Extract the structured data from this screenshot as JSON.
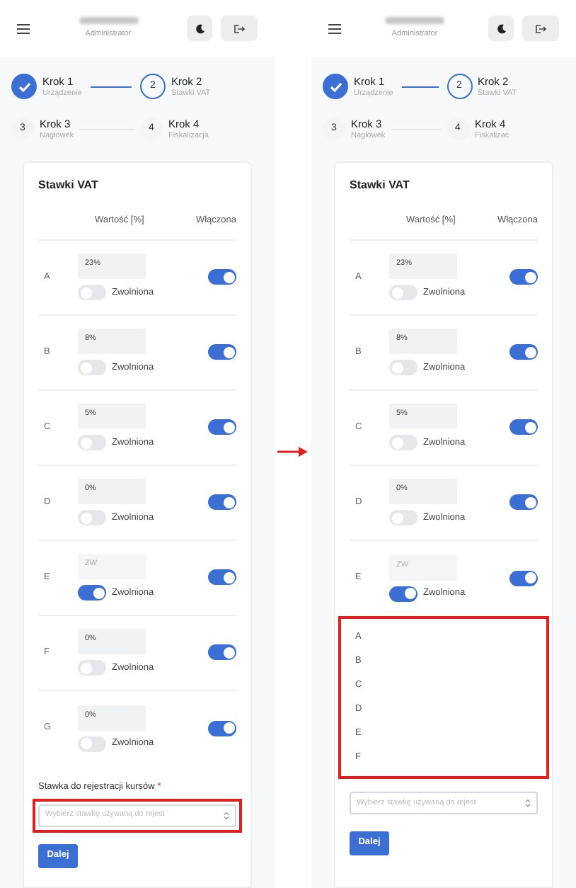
{
  "screens": [
    {
      "header": {
        "role": "Administrator"
      },
      "steps": [
        {
          "title": "Krok 1",
          "subtitle": "Urządzenie",
          "completed": true
        },
        {
          "title": "Krok 2",
          "subtitle": "Stawki VAT",
          "completed": false,
          "active": true,
          "number": "2"
        },
        {
          "title": "Krok 3",
          "subtitle": "Nagłówek",
          "completed": false,
          "active": false,
          "number": "3"
        },
        {
          "title": "Krok 4",
          "subtitle": "Fiskalizacja",
          "completed": false,
          "active": false,
          "number": "4"
        }
      ],
      "card": {
        "title": "Stawki VAT",
        "columns": [
          "Wartość [%]",
          "Włączona"
        ],
        "rates": [
          {
            "letter": "A",
            "value": "23%",
            "exempt_label": "Zwolniona",
            "exempt": false,
            "enabled": true
          },
          {
            "letter": "B",
            "value": "8%",
            "exempt_label": "Zwolniona",
            "exempt": false,
            "enabled": true
          },
          {
            "letter": "C",
            "value": "5%",
            "exempt_label": "Zwolniona",
            "exempt": false,
            "enabled": true
          },
          {
            "letter": "D",
            "value": "0%",
            "exempt_label": "Zwolniona",
            "exempt": false,
            "enabled": true
          },
          {
            "letter": "E",
            "placeholder": "ZW",
            "exempt_label": "Zwolniona",
            "exempt": true,
            "enabled": true
          },
          {
            "letter": "F",
            "value": "0%",
            "exempt_label": "Zwolniona",
            "exempt": false,
            "enabled": true
          },
          {
            "letter": "G",
            "value": "0%",
            "exempt_label": "Zwolniona",
            "exempt": false,
            "enabled": true
          }
        ],
        "select": {
          "label": "Stawka do rejestracji kursów",
          "required_mark": "*",
          "placeholder": "Wybierz stawkę używaną do rejest",
          "highlighted": true
        },
        "button": "Dalej"
      }
    },
    {
      "header": {
        "role": "Administrator"
      },
      "steps": [
        {
          "title": "Krok 1",
          "subtitle": "Urządzenie",
          "completed": true
        },
        {
          "title": "Krok 2",
          "subtitle": "Stawki VAT",
          "completed": false,
          "active": true,
          "number": "2"
        },
        {
          "title": "Krok 3",
          "subtitle": "Nagłówek",
          "completed": false,
          "active": false,
          "number": "3"
        },
        {
          "title": "Krok 4",
          "subtitle": "Fiskalizac",
          "completed": false,
          "active": false,
          "number": "4"
        }
      ],
      "card": {
        "title": "Stawki VAT",
        "columns": [
          "Wartość [%]",
          "Włączona"
        ],
        "rates": [
          {
            "letter": "A",
            "value": "23%",
            "exempt_label": "Zwolniona",
            "exempt": false,
            "enabled": true
          },
          {
            "letter": "B",
            "value": "8%",
            "exempt_label": "Zwolniona",
            "exempt": false,
            "enabled": true
          },
          {
            "letter": "C",
            "value": "5%",
            "exempt_label": "Zwolniona",
            "exempt": false,
            "enabled": true
          },
          {
            "letter": "D",
            "value": "0%",
            "exempt_label": "Zwolniona",
            "exempt": false,
            "enabled": true
          },
          {
            "letter": "E",
            "placeholder": "ZW",
            "exempt_label": "Zwolniona",
            "exempt": true,
            "enabled": true
          }
        ],
        "dropdown": {
          "highlighted": true,
          "options": [
            "A",
            "B",
            "C",
            "D",
            "E",
            "F"
          ]
        },
        "select": {
          "placeholder": "Wybierz stawkę używaną do rejest",
          "highlighted": false
        },
        "button": "Dalej"
      }
    }
  ]
}
